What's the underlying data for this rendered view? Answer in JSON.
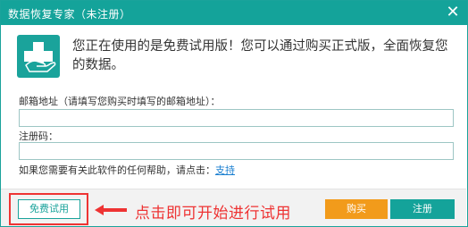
{
  "titlebar": {
    "title": "数据恢复专家（未注册）",
    "close_glyph": "✕"
  },
  "logo": {
    "icon": "medical-cross-hand-icon",
    "color": "#1aa39b"
  },
  "message": "您正在使用的是免费试用版！您可以通过购买正式版，全面恢复您的数据。",
  "form": {
    "email_label": "邮箱地址（请填写您购买时填写的邮箱地址）：",
    "email_value": "",
    "code_label": "注册码：",
    "code_value": ""
  },
  "help": {
    "text": "如果您需要有关此软件的任何帮助，请点击：",
    "link": "支持"
  },
  "footer": {
    "trial_button": "免费试用",
    "annotation": "点击即可开始进行试用",
    "buy_button": "购买",
    "register_button": "注册"
  },
  "colors": {
    "accent": "#14a39a",
    "buy": "#f29b1b",
    "annotation_red": "#ee3333"
  }
}
